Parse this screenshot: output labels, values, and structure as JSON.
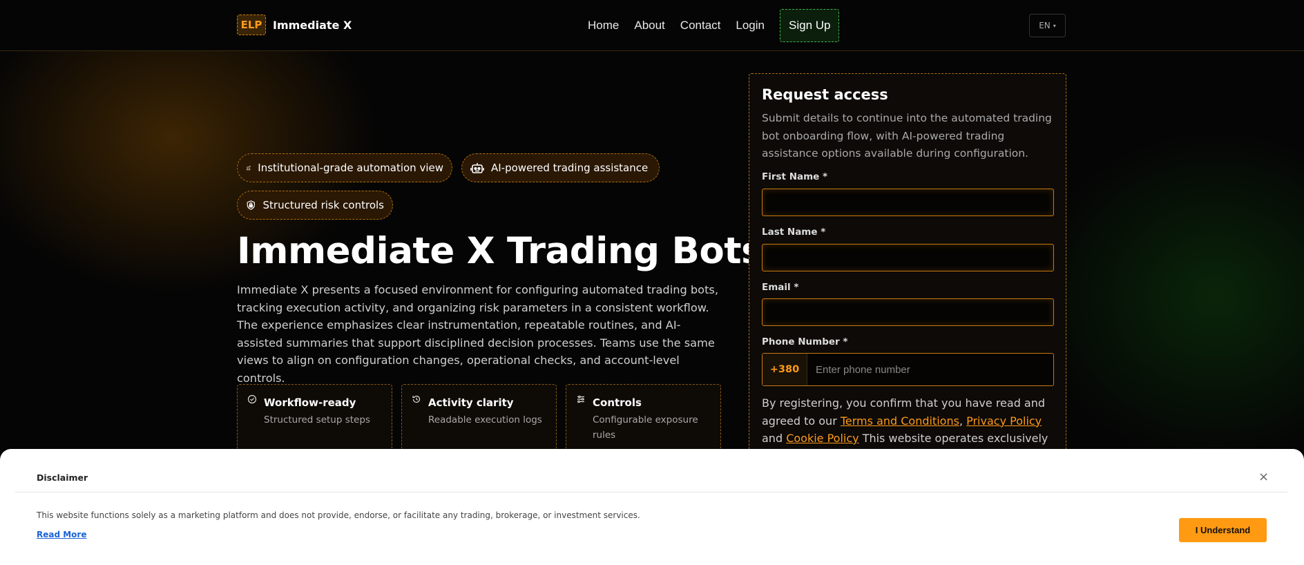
{
  "nav": {
    "logo_mark": "ELP",
    "brand": "Immediate X",
    "links": [
      "Home",
      "About",
      "Contact",
      "Login"
    ],
    "signup": "Sign Up",
    "lang": "EN",
    "lang_caret": "▾"
  },
  "hero": {
    "pills": [
      {
        "label": "Institutional-grade automation view",
        "icon": "chart-up-icon"
      },
      {
        "label": "AI-powered trading assistance",
        "icon": "robot-icon"
      },
      {
        "label": "Structured risk controls",
        "icon": "shield-lock-icon"
      }
    ],
    "title": "Immediate X Trading Bots",
    "description": "Immediate X presents a focused environment for configuring automated trading bots, tracking execution activity, and organizing risk parameters in a consistent workflow. The experience emphasizes clear instrumentation, repeatable routines, and AI-assisted summaries that support disciplined decision processes. Teams use the same views to align on configuration changes, operational checks, and account-level controls.",
    "features": [
      {
        "title": "Workflow-ready",
        "desc": "Structured setup steps",
        "icon": "check-circle-icon"
      },
      {
        "title": "Activity clarity",
        "desc": "Readable execution logs",
        "icon": "history-icon"
      },
      {
        "title": "Controls",
        "desc": "Configurable exposure rules",
        "icon": "sliders-icon"
      }
    ]
  },
  "form": {
    "title": "Request access",
    "subtitle": "Submit details to continue into the automated trading bot onboarding flow, with AI-powered trading assistance options available during configuration.",
    "first_name_label": "First Name *",
    "last_name_label": "Last Name *",
    "email_label": "Email *",
    "phone_label": "Phone Number *",
    "phone_code": "+380",
    "phone_placeholder": "Enter phone number",
    "consent_pre": "By registering, you confirm that you have read and agreed to our ",
    "terms": "Terms and Conditions",
    "comma": ", ",
    "privacy": "Privacy Policy",
    "and": " and ",
    "cookie": "Cookie Policy",
    "consent_post": " This website operates exclusively"
  },
  "disclaimer": {
    "title": "Disclaimer",
    "close": "×",
    "text": "This website functions solely as a marketing platform and does not provide, endorse, or facilitate any trading, brokerage, or investment services.",
    "read_more": "Read More",
    "button": "I Understand"
  },
  "colors": {
    "accent": "#ff9a1a",
    "signup_border": "#3fb54a",
    "background": "#050505"
  }
}
